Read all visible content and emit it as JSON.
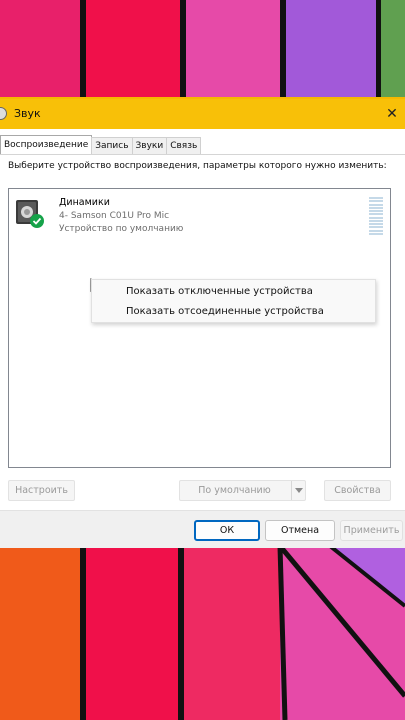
{
  "window": {
    "title": "Звук",
    "close_glyph": "✕"
  },
  "tabs": [
    {
      "label": "Воспроизведение",
      "active": true
    },
    {
      "label": "Запись",
      "active": false
    },
    {
      "label": "Звуки",
      "active": false
    },
    {
      "label": "Связь",
      "active": false
    }
  ],
  "playback": {
    "prompt": "Выберите устройство воспроизведения, параметры которого нужно изменить:",
    "device": {
      "name": "Динамики",
      "subtitle": "4- Samson C01U Pro Mic",
      "status": "Устройство по умолчанию",
      "level_segments": 12
    },
    "context_menu": {
      "items": [
        "Показать отключенные устройства",
        "Показать отсоединенные устройства"
      ]
    },
    "buttons": {
      "configure": "Настроить",
      "default": "По умолчанию",
      "properties": "Свойства"
    }
  },
  "footer": {
    "ok": "ОК",
    "cancel": "Отмена",
    "apply": "Применить"
  },
  "colors": {
    "title_bar": "#f8c008",
    "focus_border": "#0067c0",
    "check_green": "#16a34a"
  }
}
